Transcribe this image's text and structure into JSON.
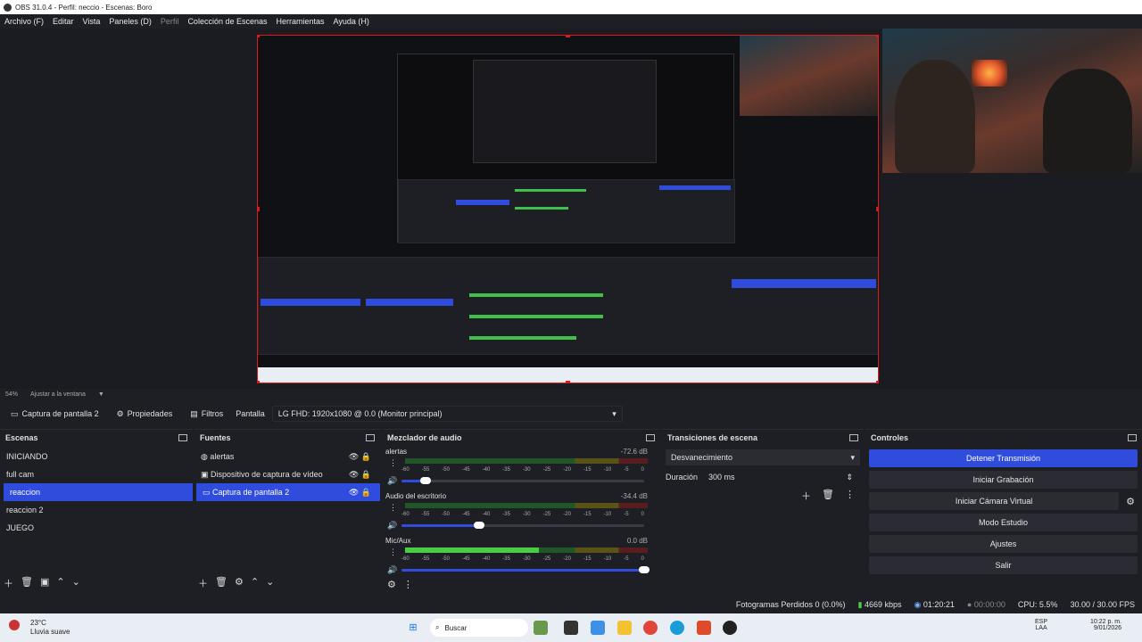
{
  "window": {
    "title": "OBS 31.0.4 - Perfil: neccio - Escenas: Boro"
  },
  "menu": {
    "items": [
      "Archivo (F)",
      "Editar",
      "Vista",
      "Paneles (D)",
      "Perfil",
      "Colección de Escenas",
      "Herramientas",
      "Ayuda (H)"
    ]
  },
  "zoom": {
    "percent": "54%",
    "fit_label": "Ajustar a la ventana"
  },
  "source_toolbar": {
    "source_name": "Captura de pantalla 2",
    "properties": "Propiedades",
    "filters": "Filtros",
    "screen_label": "Pantalla",
    "screen_value": "LG FHD: 1920x1080 @ 0.0 (Monitor principal)"
  },
  "scenes": {
    "title": "Escenas",
    "items": [
      "INICIANDO",
      "full cam",
      "reaccion",
      "reaccion 2",
      "JUEGO"
    ],
    "selected_index": 2
  },
  "sources": {
    "title": "Fuentes",
    "items": [
      {
        "name": "alertas",
        "icon": "globe-icon"
      },
      {
        "name": "Dispositivo de captura de vídeo",
        "icon": "camera-icon"
      },
      {
        "name": "Captura de pantalla 2",
        "icon": "monitor-icon"
      }
    ],
    "selected_index": 2
  },
  "mixer": {
    "title": "Mezclador de audio",
    "ticks": [
      "-60",
      "-55",
      "-50",
      "-45",
      "-40",
      "-35",
      "-30",
      "-25",
      "-20",
      "-15",
      "-10",
      "-5",
      "0"
    ],
    "channels": [
      {
        "name": "alertas",
        "db": "-72.6 dB",
        "level": 0.0,
        "volume": 0.1
      },
      {
        "name": "Audio del escritorio",
        "db": "-34.4 dB",
        "level": 0.0,
        "volume": 0.32
      },
      {
        "name": "Mic/Aux",
        "db": "0.0 dB",
        "level": 0.55,
        "volume": 1.0
      }
    ]
  },
  "transitions": {
    "title": "Transiciones de escena",
    "selected": "Desvanecimiento",
    "duration_label": "Duración",
    "duration_value": "300 ms"
  },
  "controls": {
    "title": "Controles",
    "buttons": [
      "Detener Transmisión",
      "Iniciar Grabación",
      "Iniciar Cámara Virtual",
      "Modo Estudio",
      "Ajustes",
      "Salir"
    ]
  },
  "status": {
    "dropped": "Fotogramas Perdidos 0 (0.0%)",
    "bitrate": "4669 kbps",
    "stream_time": "01:20:21",
    "rec_time": "00:00:00",
    "cpu": "CPU: 5.5%",
    "fps": "30.00 / 30.00 FPS"
  },
  "taskbar": {
    "weather_temp": "23°C",
    "weather_desc": "Lluvia suave",
    "search_placeholder": "Buscar",
    "lang_top": "ESP",
    "lang_bottom": "LAA",
    "time": "10:22 p. m.",
    "date": "9/01/2026"
  },
  "colors": {
    "accent": "#2f4cdd",
    "selection_border": "#e01818",
    "meter_green": "#4ccc46"
  }
}
